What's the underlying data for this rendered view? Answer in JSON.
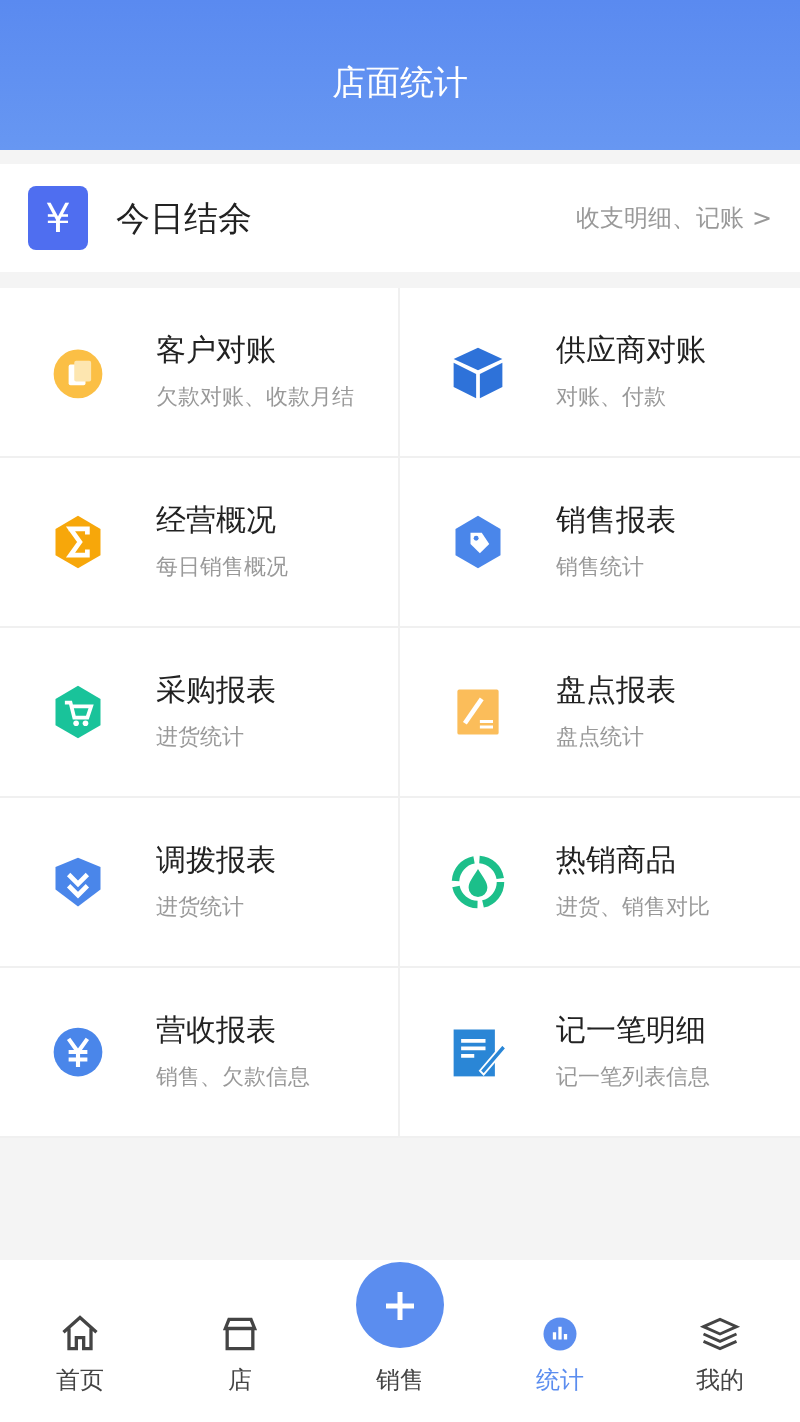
{
  "header": {
    "title": "店面统计"
  },
  "balance": {
    "icon": "¥",
    "title": "今日结余",
    "link": "收支明细、记账 >"
  },
  "items": [
    {
      "title": "客户对账",
      "subtitle": "欠款对账、收款月结",
      "kind": "badge",
      "color": "#fbbf45"
    },
    {
      "title": "供应商对账",
      "subtitle": "对账、付款",
      "kind": "cube",
      "color": "#2e72d9"
    },
    {
      "title": "经营概况",
      "subtitle": "每日销售概况",
      "kind": "sigma",
      "color": "#f7a70a"
    },
    {
      "title": "销售报表",
      "subtitle": "销售统计",
      "kind": "tag",
      "color": "#4a86ea"
    },
    {
      "title": "采购报表",
      "subtitle": "进货统计",
      "kind": "cart",
      "color": "#19c39a"
    },
    {
      "title": "盘点报表",
      "subtitle": "盘点统计",
      "kind": "note",
      "color": "#fbbd5a"
    },
    {
      "title": "调拨报表",
      "subtitle": "进货统计",
      "kind": "shield",
      "color": "#4a86ea"
    },
    {
      "title": "热销商品",
      "subtitle": "进货、销售对比",
      "kind": "ring",
      "color": "#1cbf8a"
    },
    {
      "title": "营收报表",
      "subtitle": "销售、欠款信息",
      "kind": "yen",
      "color": "#4a86ea"
    },
    {
      "title": "记一笔明细",
      "subtitle": "记一笔列表信息",
      "kind": "doc",
      "color": "#2a86d6"
    }
  ],
  "nav": [
    {
      "label": "首页",
      "kind": "home",
      "selected": false
    },
    {
      "label": "店",
      "kind": "store",
      "selected": false
    },
    {
      "label": "销售",
      "kind": "center",
      "selected": false
    },
    {
      "label": "统计",
      "kind": "chart",
      "selected": true
    },
    {
      "label": "我的",
      "kind": "user",
      "selected": false
    }
  ]
}
